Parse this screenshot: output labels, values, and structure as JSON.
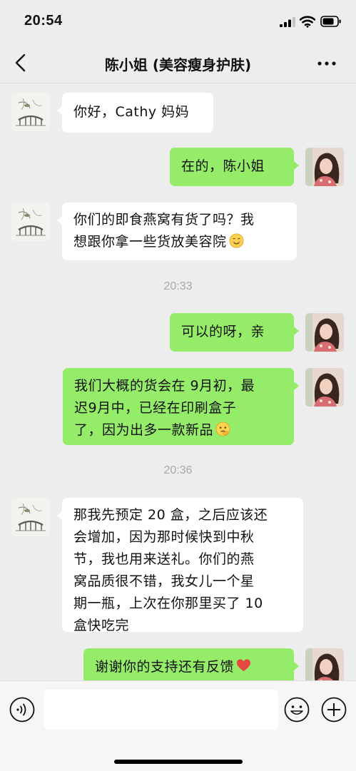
{
  "status_bar": {
    "time": "20:54"
  },
  "header": {
    "title": "陈小姐 (美容瘦身护肤)"
  },
  "messages": [
    {
      "side": "in",
      "text": "你好，Cathy 妈妈"
    },
    {
      "side": "out",
      "text": "在的，陈小姐"
    },
    {
      "side": "in",
      "line1": "你们的即食燕窝有货了吗？我",
      "line2": "想跟你拿一些货放美容院",
      "emoji": "smile-emoji"
    },
    {
      "side": "out",
      "text": "可以的呀，亲"
    },
    {
      "side": "out",
      "line1": "我们大概的货会在 9月初，最",
      "line2": "迟9月中，已经在印刷盒子",
      "line3": "了，因为出多一款新品",
      "emoji": "thinking-emoji"
    },
    {
      "side": "in",
      "line1": "那我先预定 20 盒，之后应该还",
      "line2": "会增加，因为那时候快到中秋",
      "line3": "节，我也用来送礼。你们的燕",
      "line4": "窝品质很不错，我女儿一个星",
      "line5": "期一瓶，上次在你那里买了 10",
      "line6": "盒快吃完"
    },
    {
      "side": "out",
      "text": "谢谢你的支持还有反馈",
      "emoji": "heart-emoji"
    }
  ],
  "timestamps": [
    "20:33",
    "20:36"
  ],
  "input": {
    "placeholder": ""
  },
  "colors": {
    "background": "#ededed",
    "bubble_out": "#95ec69",
    "bubble_in": "#ffffff"
  }
}
